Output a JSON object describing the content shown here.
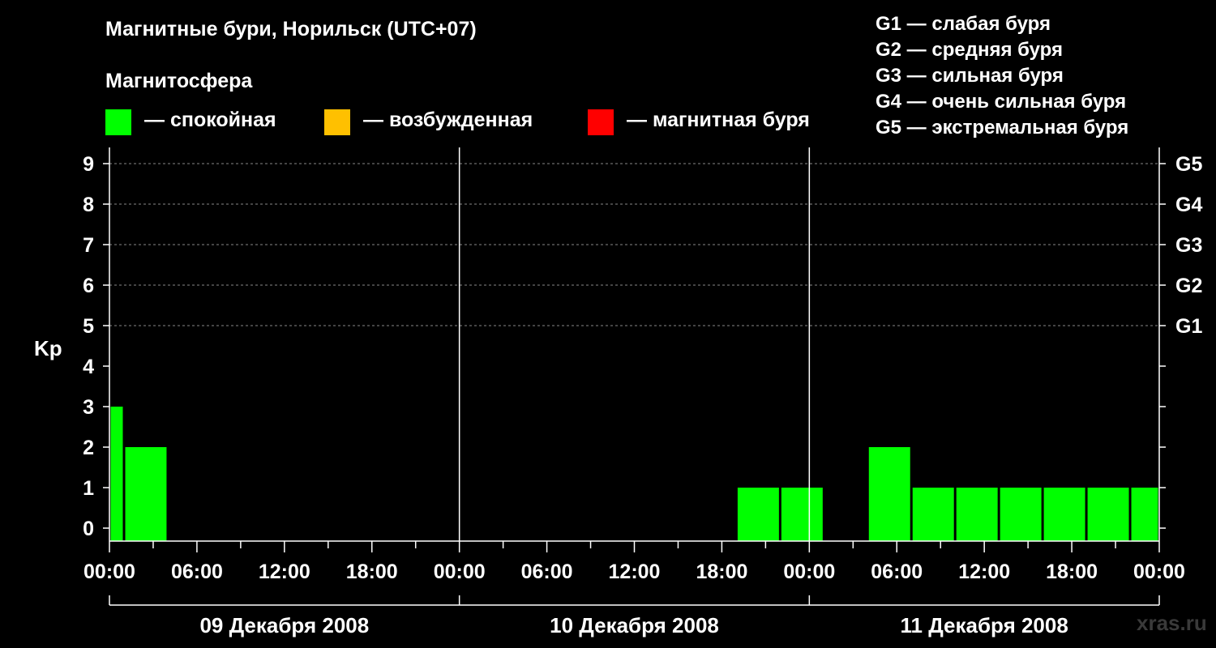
{
  "title": "Магнитные бури, Норильск (UTC+07)",
  "legend": {
    "title": "Магнитосфера",
    "items": [
      {
        "color": "#00ff00",
        "label": "— спокойная"
      },
      {
        "color": "#ffc000",
        "label": "— возбужденная"
      },
      {
        "color": "#ff0000",
        "label": "— магнитная буря"
      }
    ]
  },
  "storm_levels": [
    "G1 — слабая буря",
    "G2 — средняя буря",
    "G3 — сильная буря",
    "G4 — очень сильная буря",
    "G5 — экстремальная буря"
  ],
  "watermark": "xras.ru",
  "chart_data": {
    "type": "bar",
    "ylabel": "Kp",
    "ylim": [
      0,
      9
    ],
    "y_ticks": [
      "0",
      "1",
      "2",
      "3",
      "4",
      "5",
      "6",
      "7",
      "8",
      "9"
    ],
    "right_ticks": [
      {
        "y": 5,
        "label": "G1"
      },
      {
        "y": 6,
        "label": "G2"
      },
      {
        "y": 7,
        "label": "G3"
      },
      {
        "y": 8,
        "label": "G4"
      },
      {
        "y": 9,
        "label": "G5"
      }
    ],
    "x_range_hours": [
      0,
      72
    ],
    "x_tick_labels": [
      "00:00",
      "06:00",
      "12:00",
      "18:00",
      "00:00",
      "06:00",
      "12:00",
      "18:00",
      "00:00",
      "06:00",
      "12:00",
      "18:00",
      "00:00"
    ],
    "days": [
      "09 Декабря 2008",
      "10 Декабря 2008",
      "11 Декабря 2008"
    ],
    "grid": true,
    "bar_color": "#00ff00",
    "bars": [
      {
        "start_hour": 0,
        "end_hour": 1,
        "value": 3
      },
      {
        "start_hour": 1,
        "end_hour": 4,
        "value": 2
      },
      {
        "start_hour": 43,
        "end_hour": 46,
        "value": 1
      },
      {
        "start_hour": 46,
        "end_hour": 49,
        "value": 1
      },
      {
        "start_hour": 52,
        "end_hour": 55,
        "value": 2
      },
      {
        "start_hour": 55,
        "end_hour": 58,
        "value": 1
      },
      {
        "start_hour": 58,
        "end_hour": 61,
        "value": 1
      },
      {
        "start_hour": 61,
        "end_hour": 64,
        "value": 1
      },
      {
        "start_hour": 64,
        "end_hour": 67,
        "value": 1
      },
      {
        "start_hour": 67,
        "end_hour": 70,
        "value": 1
      },
      {
        "start_hour": 70,
        "end_hour": 72,
        "value": 1
      }
    ]
  }
}
